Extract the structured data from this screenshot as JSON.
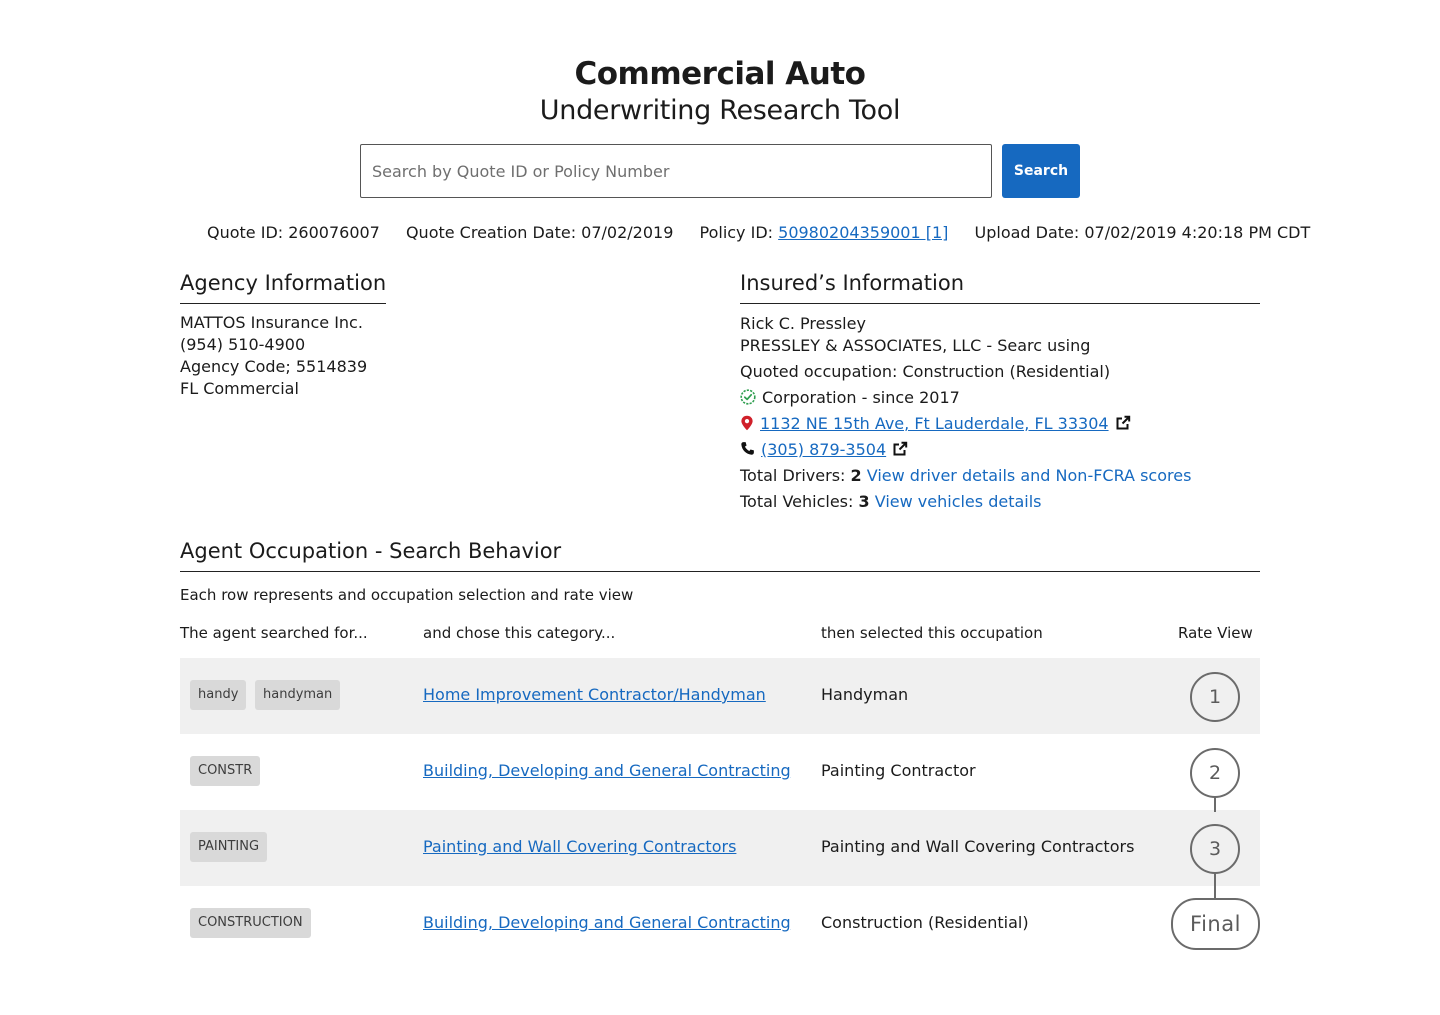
{
  "header": {
    "title": "Commercial Auto",
    "subtitle": "Underwriting Research Tool"
  },
  "search": {
    "placeholder": "Search by Quote ID or Policy Number",
    "value": "",
    "button_label": "Search"
  },
  "meta": {
    "quote_id": "Quote ID: 260076007",
    "quote_creation_date": "Quote Creation Date: 07/02/2019",
    "policy_id_label": "Policy ID:",
    "policy_id_link": "50980204359001 [1]",
    "upload_date": "Upload Date: 07/02/2019 4:20:18 PM CDT"
  },
  "agency": {
    "heading": "Agency Information",
    "name": "MATTOS Insurance Inc.",
    "phone": "(954) 510-4900",
    "code": "Agency Code; 5514839",
    "region": "FL Commercial"
  },
  "insured": {
    "heading": "Insured’s Information",
    "name": "Rick C. Pressley",
    "company": "PRESSLEY & ASSOCIATES, LLC - Searc using",
    "occupation": "Quoted occupation: Construction (Residential)",
    "entity": "Corporation - since 2017",
    "address": "1132 NE 15th Ave, Ft Lauderdale, FL 33304",
    "phone": "(305) 879-3504",
    "drivers_label": "Total Drivers:",
    "drivers_count": "2",
    "drivers_link": "View driver details and Non-FCRA scores",
    "vehicles_label": "Total Vehicles:",
    "vehicles_count": "3",
    "vehicles_link": "View vehicles details",
    "colors": {
      "verified": "#2e9e4f",
      "pin": "#d0202a",
      "link": "#1669c0"
    }
  },
  "behavior": {
    "heading": "Agent Occupation - Search Behavior",
    "description": "Each row represents and occupation selection and rate view",
    "columns": {
      "searched": "The agent searched for...",
      "category": "and chose this category...",
      "occupation": "then selected this occupation",
      "rate_view": "Rate View"
    },
    "rows": [
      {
        "tags": [
          "handy",
          "handyman"
        ],
        "category": "Home Improvement Contractor/Handyman",
        "occupation": "Handyman",
        "rate_view": "1"
      },
      {
        "tags": [
          "CONSTR"
        ],
        "category": "Building, Developing and General Contracting",
        "occupation": "Painting Contractor",
        "rate_view": "2"
      },
      {
        "tags": [
          "PAINTING"
        ],
        "category": "Painting and Wall Covering Contractors",
        "occupation": "Painting and Wall Covering Contractors",
        "rate_view": "3"
      },
      {
        "tags": [
          "CONSTRUCTION"
        ],
        "category": "Building, Developing and General Contracting",
        "occupation": "Construction (Residential)",
        "rate_view": "Final"
      }
    ]
  }
}
